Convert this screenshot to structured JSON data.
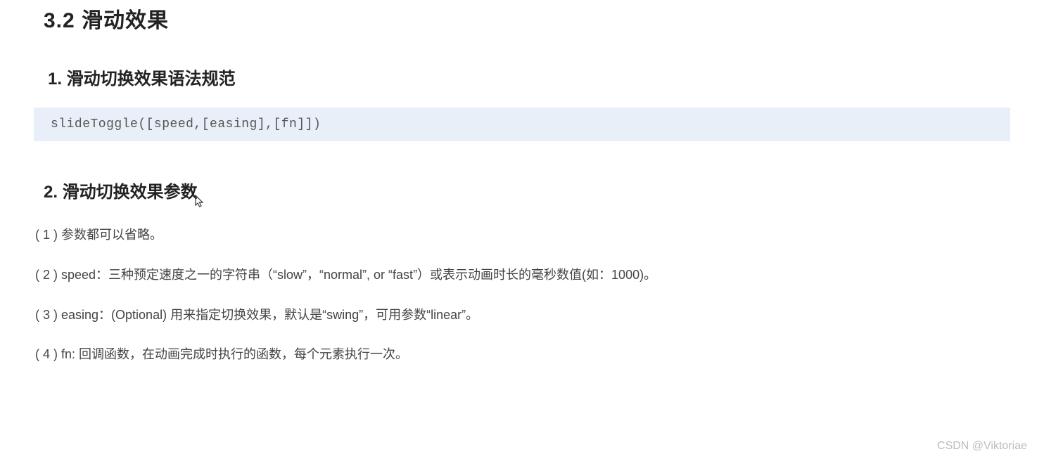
{
  "heading": "3.2  滑动效果",
  "section1": {
    "title": "1. 滑动切换效果语法规范",
    "code": "slideToggle([speed,[easing],[fn]])"
  },
  "section2": {
    "title": "2. 滑动切换效果参数",
    "params": [
      "( 1 ) 参数都可以省略。",
      "( 2 ) speed：三种预定速度之一的字符串（“slow”，“normal”, or “fast”）或表示动画时长的毫秒数值(如：1000)。",
      "( 3 ) easing：(Optional) 用来指定切换效果，默认是“swing”，可用参数“linear”。",
      "( 4 ) fn: 回调函数，在动画完成时执行的函数，每个元素执行一次。"
    ]
  },
  "watermark": "CSDN @Viktoriae"
}
